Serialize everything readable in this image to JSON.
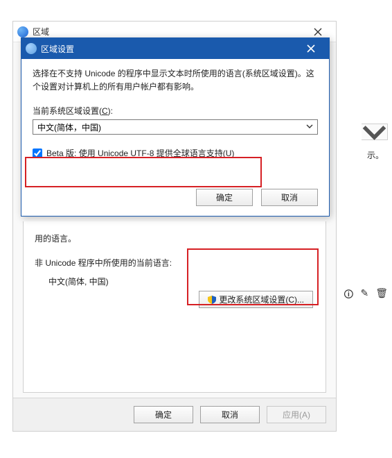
{
  "parent": {
    "title": "区域",
    "body": {
      "line1": "用的语言。",
      "line2": "非 Unicode 程序中所使用的当前语言:",
      "current_lang": "中文(简体, 中国)",
      "change_locale": "更改系统区域设置(C)..."
    },
    "footer": {
      "ok": "确定",
      "cancel": "取消",
      "apply": "应用(A)"
    }
  },
  "side": {
    "text": "示。"
  },
  "dialog": {
    "title": "区域设置",
    "desc": "选择在不支持 Unicode 的程序中显示文本时所使用的语言(系统区域设置)。这个设置对计算机上的所有用户帐户都有影响。",
    "label": "当前系统区域设置(C):",
    "combo_value": "中文(简体，中国)",
    "checkbox_label": "Beta 版: 使用 Unicode UTF-8 提供全球语言支持(U)",
    "checkbox_checked": true,
    "ok": "确定",
    "cancel": "取消"
  }
}
